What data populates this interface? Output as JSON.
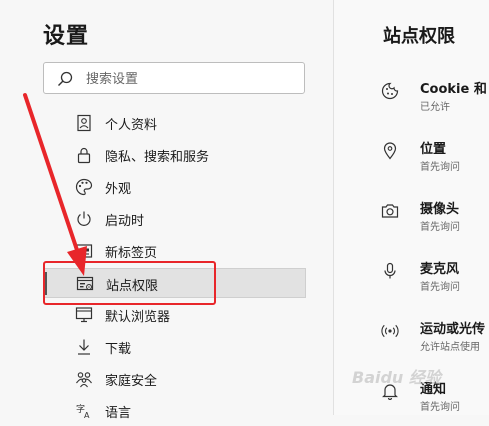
{
  "sidebar": {
    "title": "设置",
    "search_placeholder": "搜索设置",
    "items": [
      {
        "label": "个人资料",
        "icon": "person-icon"
      },
      {
        "label": "隐私、搜索和服务",
        "icon": "lock-icon"
      },
      {
        "label": "外观",
        "icon": "palette-icon"
      },
      {
        "label": "启动时",
        "icon": "power-icon"
      },
      {
        "label": "新标签页",
        "icon": "new-tab-icon"
      },
      {
        "label": "站点权限",
        "icon": "site-permissions-icon",
        "active": true
      },
      {
        "label": "默认浏览器",
        "icon": "default-browser-icon"
      },
      {
        "label": "下载",
        "icon": "download-icon"
      },
      {
        "label": "家庭安全",
        "icon": "family-icon"
      },
      {
        "label": "语言",
        "icon": "language-icon"
      }
    ]
  },
  "panel": {
    "title": "站点权限",
    "permissions": [
      {
        "name": "Cookie 和",
        "status": "已允许",
        "icon": "cookie-icon"
      },
      {
        "name": "位置",
        "status": "首先询问",
        "icon": "location-icon"
      },
      {
        "name": "摄像头",
        "status": "首先询问",
        "icon": "camera-icon"
      },
      {
        "name": "麦克风",
        "status": "首先询问",
        "icon": "microphone-icon"
      },
      {
        "name": "运动或光传",
        "status": "允许站点使用",
        "icon": "motion-sensor-icon"
      },
      {
        "name": "通知",
        "status": "首先询问",
        "icon": "bell-icon"
      }
    ]
  },
  "watermark": "Baidu 经验",
  "colors": {
    "annotation": "#e8262a",
    "active_bg": "#e2e2e2",
    "accent": "#555555"
  }
}
